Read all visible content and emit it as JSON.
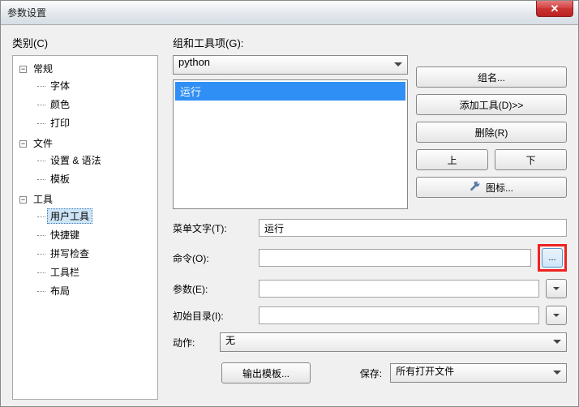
{
  "window": {
    "title": "参数设置"
  },
  "left": {
    "label": "类别(C)",
    "tree": {
      "n0": "常规",
      "n0c": [
        "字体",
        "颜色",
        "打印"
      ],
      "n1": "文件",
      "n1c": [
        "设置 & 语法",
        "模板"
      ],
      "n2": "工具",
      "n2c": [
        "用户工具",
        "快捷键",
        "拼写检查",
        "工具栏",
        "布局"
      ],
      "selected": "用户工具"
    }
  },
  "group": {
    "label": "组和工具项(G):",
    "selected": "python",
    "items": [
      "运行"
    ]
  },
  "buttons": {
    "group_name": "组名...",
    "add_tool": "添加工具(D)>>",
    "delete": "删除(R)",
    "up": "上",
    "down": "下",
    "icon": "图标..."
  },
  "form": {
    "menu_text_label": "菜单文字(T):",
    "menu_text_value": "运行",
    "command_label": "命令(O):",
    "command_value": "",
    "params_label": "参数(E):",
    "params_value": "",
    "initdir_label": "初始目录(I):",
    "initdir_value": "",
    "action_label": "动作:",
    "action_value": "无",
    "browse": "..."
  },
  "bottom": {
    "output_template": "输出模板...",
    "save_label": "保存:",
    "save_value": "所有打开文件"
  }
}
